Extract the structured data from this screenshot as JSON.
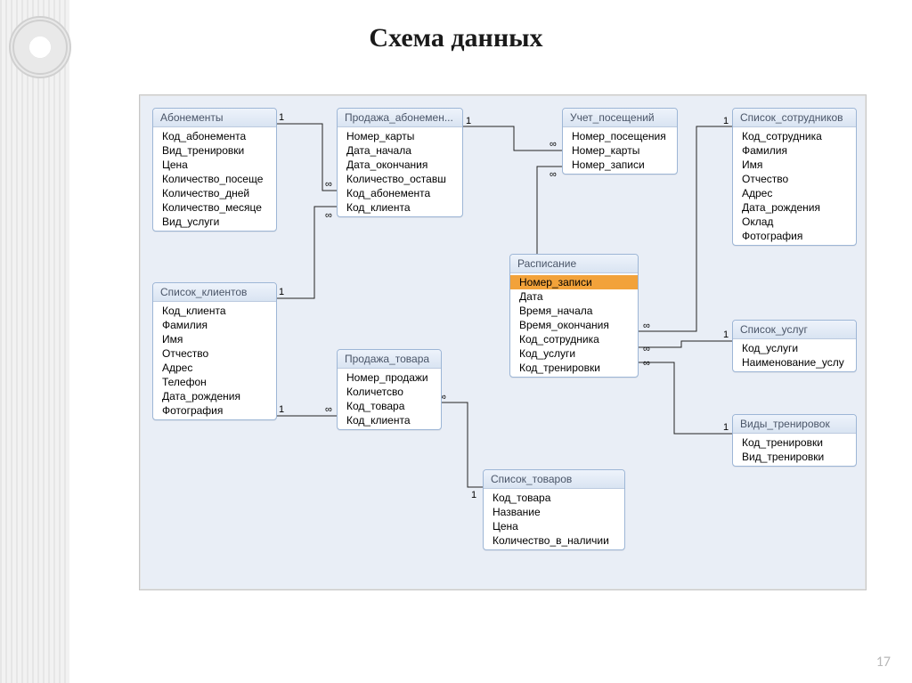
{
  "title": "Схема данных",
  "slide_number": "17",
  "relationships": {
    "one": "1",
    "many": "∞"
  },
  "tables": {
    "abonements": {
      "title": "Абонементы",
      "fields": [
        "Код_абонемента",
        "Вид_тренировки",
        "Цена",
        "Количество_посеще",
        "Количество_дней",
        "Количество_месяце",
        "Вид_услуги"
      ]
    },
    "sale_abon": {
      "title": "Продажа_абонемен...",
      "fields": [
        "Номер_карты",
        "Дата_начала",
        "Дата_окончания",
        "Количество_оставш",
        "Код_абонемента",
        "Код_клиента"
      ]
    },
    "visits": {
      "title": "Учет_посещений",
      "fields": [
        "Номер_посещения",
        "Номер_карты",
        "Номер_записи"
      ]
    },
    "employees": {
      "title": "Список_сотрудников",
      "fields": [
        "Код_сотрудника",
        "Фамилия",
        "Имя",
        "Отчество",
        "Адрес",
        "Дата_рождения",
        "Оклад",
        "Фотография"
      ]
    },
    "clients": {
      "title": "Список_клиентов",
      "fields": [
        "Код_клиента",
        "Фамилия",
        "Имя",
        "Отчество",
        "Адрес",
        "Телефон",
        "Дата_рождения",
        "Фотография"
      ]
    },
    "sale_goods": {
      "title": "Продажа_товара",
      "fields": [
        "Номер_продажи",
        "Количетсво",
        "Код_товара",
        "Код_клиента"
      ]
    },
    "schedule": {
      "title": "Расписание",
      "fields": [
        "Номер_записи",
        "Дата",
        "Время_начала",
        "Время_окончания",
        "Код_сотрудника",
        "Код_услуги",
        "Код_тренировки"
      ]
    },
    "services": {
      "title": "Список_услуг",
      "fields": [
        "Код_услуги",
        "Наименование_услу"
      ]
    },
    "trainings": {
      "title": "Виды_тренировок",
      "fields": [
        "Код_тренировки",
        "Вид_тренировки"
      ]
    },
    "goods": {
      "title": "Список_товаров",
      "fields": [
        "Код_товара",
        "Название",
        "Цена",
        "Количество_в_наличии"
      ]
    }
  }
}
